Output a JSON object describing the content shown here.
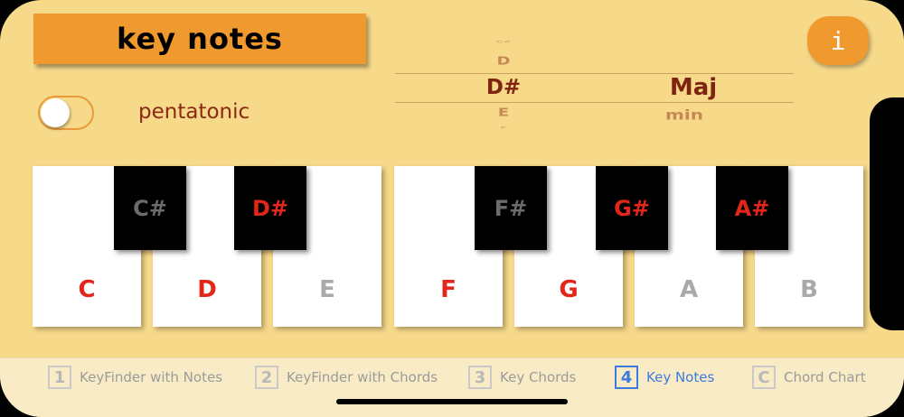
{
  "header": {
    "title": "key notes",
    "info_label": "i"
  },
  "toggle": {
    "label": "pentatonic",
    "state": "off"
  },
  "picker": {
    "notes": [
      "C#",
      "D",
      "D#",
      "E",
      "F"
    ],
    "selected_note": "D#",
    "modes": [
      "Maj",
      "min"
    ],
    "selected_mode": "Maj"
  },
  "keyboard": {
    "white_keys": [
      {
        "label": "C",
        "color": "#e3261a"
      },
      {
        "label": "D",
        "color": "#e3261a"
      },
      {
        "label": "E",
        "color": "#a9a9a9"
      },
      {
        "label": "F",
        "color": "#e3261a"
      },
      {
        "label": "G",
        "color": "#e3261a"
      },
      {
        "label": "A",
        "color": "#a9a9a9"
      },
      {
        "label": "B",
        "color": "#a9a9a9"
      }
    ],
    "black_keys": [
      {
        "label": "C#",
        "color": "#6b6b6b"
      },
      {
        "label": "D#",
        "color": "#e3261a"
      },
      {
        "label": "F#",
        "color": "#6b6b6b"
      },
      {
        "label": "G#",
        "color": "#e3261a"
      },
      {
        "label": "A#",
        "color": "#e3261a"
      }
    ]
  },
  "tabs": [
    {
      "num": "1",
      "label": "KeyFinder with Notes"
    },
    {
      "num": "2",
      "label": "KeyFinder with Chords"
    },
    {
      "num": "3",
      "label": "Key Chords"
    },
    {
      "num": "4",
      "label": "Key Notes"
    },
    {
      "num": "C",
      "label": "Chord Chart"
    }
  ],
  "colors": {
    "background": "#f7d98a",
    "accent": "#f0992e",
    "in_key": "#e3261a",
    "out_of_key": "#a9a9a9",
    "tab_active": "#3b7be0"
  }
}
